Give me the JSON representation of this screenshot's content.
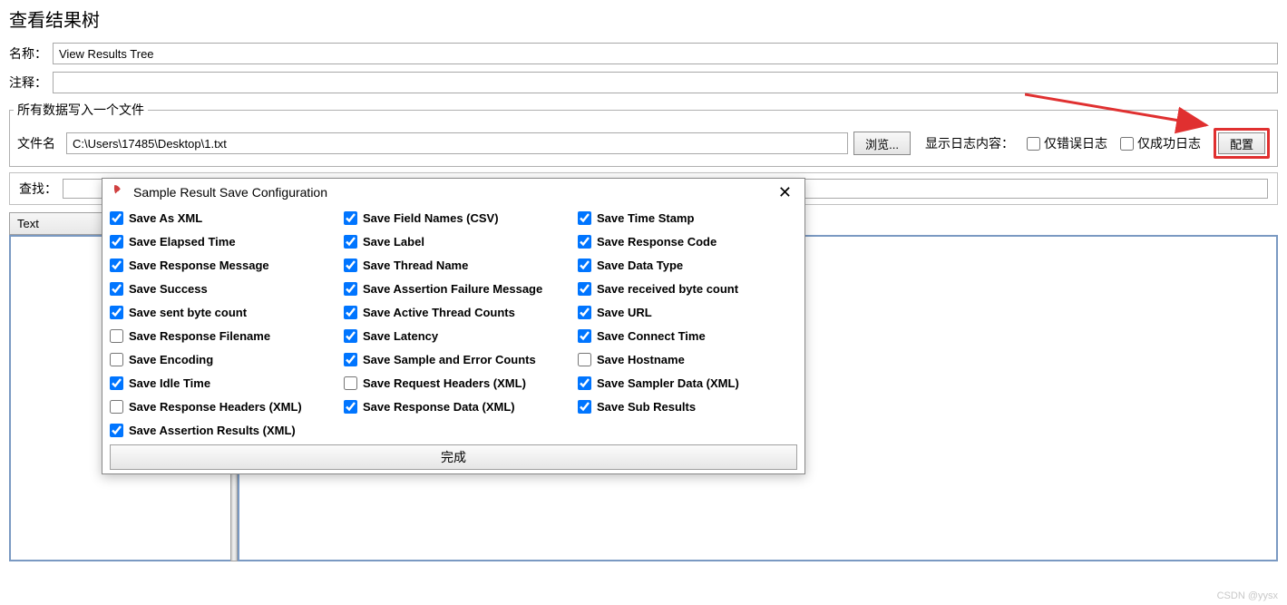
{
  "title": "查看结果树",
  "nameLabel": "名称：",
  "nameValue": "View Results Tree",
  "commentLabel": "注释：",
  "commentValue": "",
  "fieldsetLegend": "所有数据写入一个文件",
  "fileLabel": "文件名",
  "fileValue": "C:\\Users\\17485\\Desktop\\1.txt",
  "browseBtn": "浏览...",
  "logsLabel": "显示日志内容：",
  "errorOnly": "仅错误日志",
  "successOnly": "仅成功日志",
  "configBtn": "配置",
  "searchLabel": "查找：",
  "searchValue": "",
  "textTab": "Text",
  "dialog": {
    "title": "Sample Result Save Configuration",
    "done": "完成",
    "options": [
      {
        "label": "Save As XML",
        "checked": true
      },
      {
        "label": "Save Field Names (CSV)",
        "checked": true
      },
      {
        "label": "Save Time Stamp",
        "checked": true
      },
      {
        "label": "Save Elapsed Time",
        "checked": true
      },
      {
        "label": "Save Label",
        "checked": true
      },
      {
        "label": "Save Response Code",
        "checked": true
      },
      {
        "label": "Save Response Message",
        "checked": true
      },
      {
        "label": "Save Thread Name",
        "checked": true
      },
      {
        "label": "Save Data Type",
        "checked": true
      },
      {
        "label": "Save Success",
        "checked": true
      },
      {
        "label": "Save Assertion Failure Message",
        "checked": true
      },
      {
        "label": "Save received byte count",
        "checked": true
      },
      {
        "label": "Save sent byte count",
        "checked": true
      },
      {
        "label": "Save Active Thread Counts",
        "checked": true
      },
      {
        "label": "Save URL",
        "checked": true
      },
      {
        "label": "Save Response Filename",
        "checked": false
      },
      {
        "label": "Save Latency",
        "checked": true
      },
      {
        "label": "Save Connect Time",
        "checked": true
      },
      {
        "label": "Save Encoding",
        "checked": false
      },
      {
        "label": "Save Sample and Error Counts",
        "checked": true
      },
      {
        "label": "Save Hostname",
        "checked": false
      },
      {
        "label": "Save Idle Time",
        "checked": true
      },
      {
        "label": "Save Request Headers (XML)",
        "checked": false
      },
      {
        "label": "Save Sampler Data (XML)",
        "checked": true
      },
      {
        "label": "Save Response Headers (XML)",
        "checked": false
      },
      {
        "label": "Save Response Data (XML)",
        "checked": true
      },
      {
        "label": "Save Sub Results",
        "checked": true
      },
      {
        "label": "Save Assertion Results (XML)",
        "checked": true
      }
    ]
  },
  "watermark": "CSDN @yysx"
}
